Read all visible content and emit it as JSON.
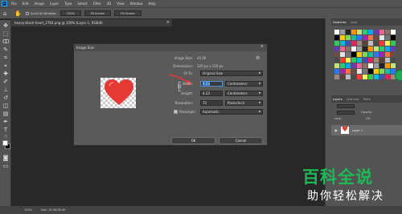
{
  "menubar": {
    "logo": "Ps",
    "items": [
      "File",
      "Edit",
      "Image",
      "Layer",
      "Type",
      "Select",
      "Filter",
      "3D",
      "View",
      "Window",
      "Help"
    ]
  },
  "options": {
    "checkbox_label": "Scroll All Windows",
    "zoom_btn": "100%",
    "fit_btn": "Fit Screen",
    "fill_btn": "Fill Screen"
  },
  "document": {
    "tab_title": "heavy-black-heart_2764.png @ 100% (Layer 1, RGB/8)"
  },
  "panels": {
    "swatch_tabs": [
      "Swatches",
      "Color"
    ],
    "layer_tabs": [
      "Layers",
      "Channels",
      "Paths"
    ],
    "lock_label": "Lock:",
    "opacity_label": "Opacity:",
    "fill_label": "Fill:",
    "layer_name": "Layer 1"
  },
  "status": {
    "zoom": "100%",
    "doc": "Doc: 18.0K/36.0K"
  },
  "dialog": {
    "title": "Image Size",
    "image_size_label": "Image Size:",
    "image_size_value": "43.2K",
    "dimensions_label": "Dimensions:",
    "dimensions_value": "120 px  x  120 px",
    "fit_to_label": "Fit To:",
    "fit_to_value": "Original Size",
    "width_label": "Width:",
    "width_value": "4.23",
    "width_unit": "Centimeters",
    "height_label": "Height:",
    "height_value": "4.23",
    "height_unit": "Centimeters",
    "resolution_label": "Resolution:",
    "resolution_value": "72",
    "resolution_unit": "Pixels/Inch",
    "resample_label": "Resample:",
    "resample_value": "Automatic",
    "ok_label": "OK",
    "cancel_label": "Cancel"
  },
  "watermark": {
    "line1": "百科全说",
    "line2": "助你轻松解决"
  },
  "colors": {
    "accent_green": "#1db954",
    "heart_red": "#e53935",
    "selection_blue": "#2f6db5"
  }
}
